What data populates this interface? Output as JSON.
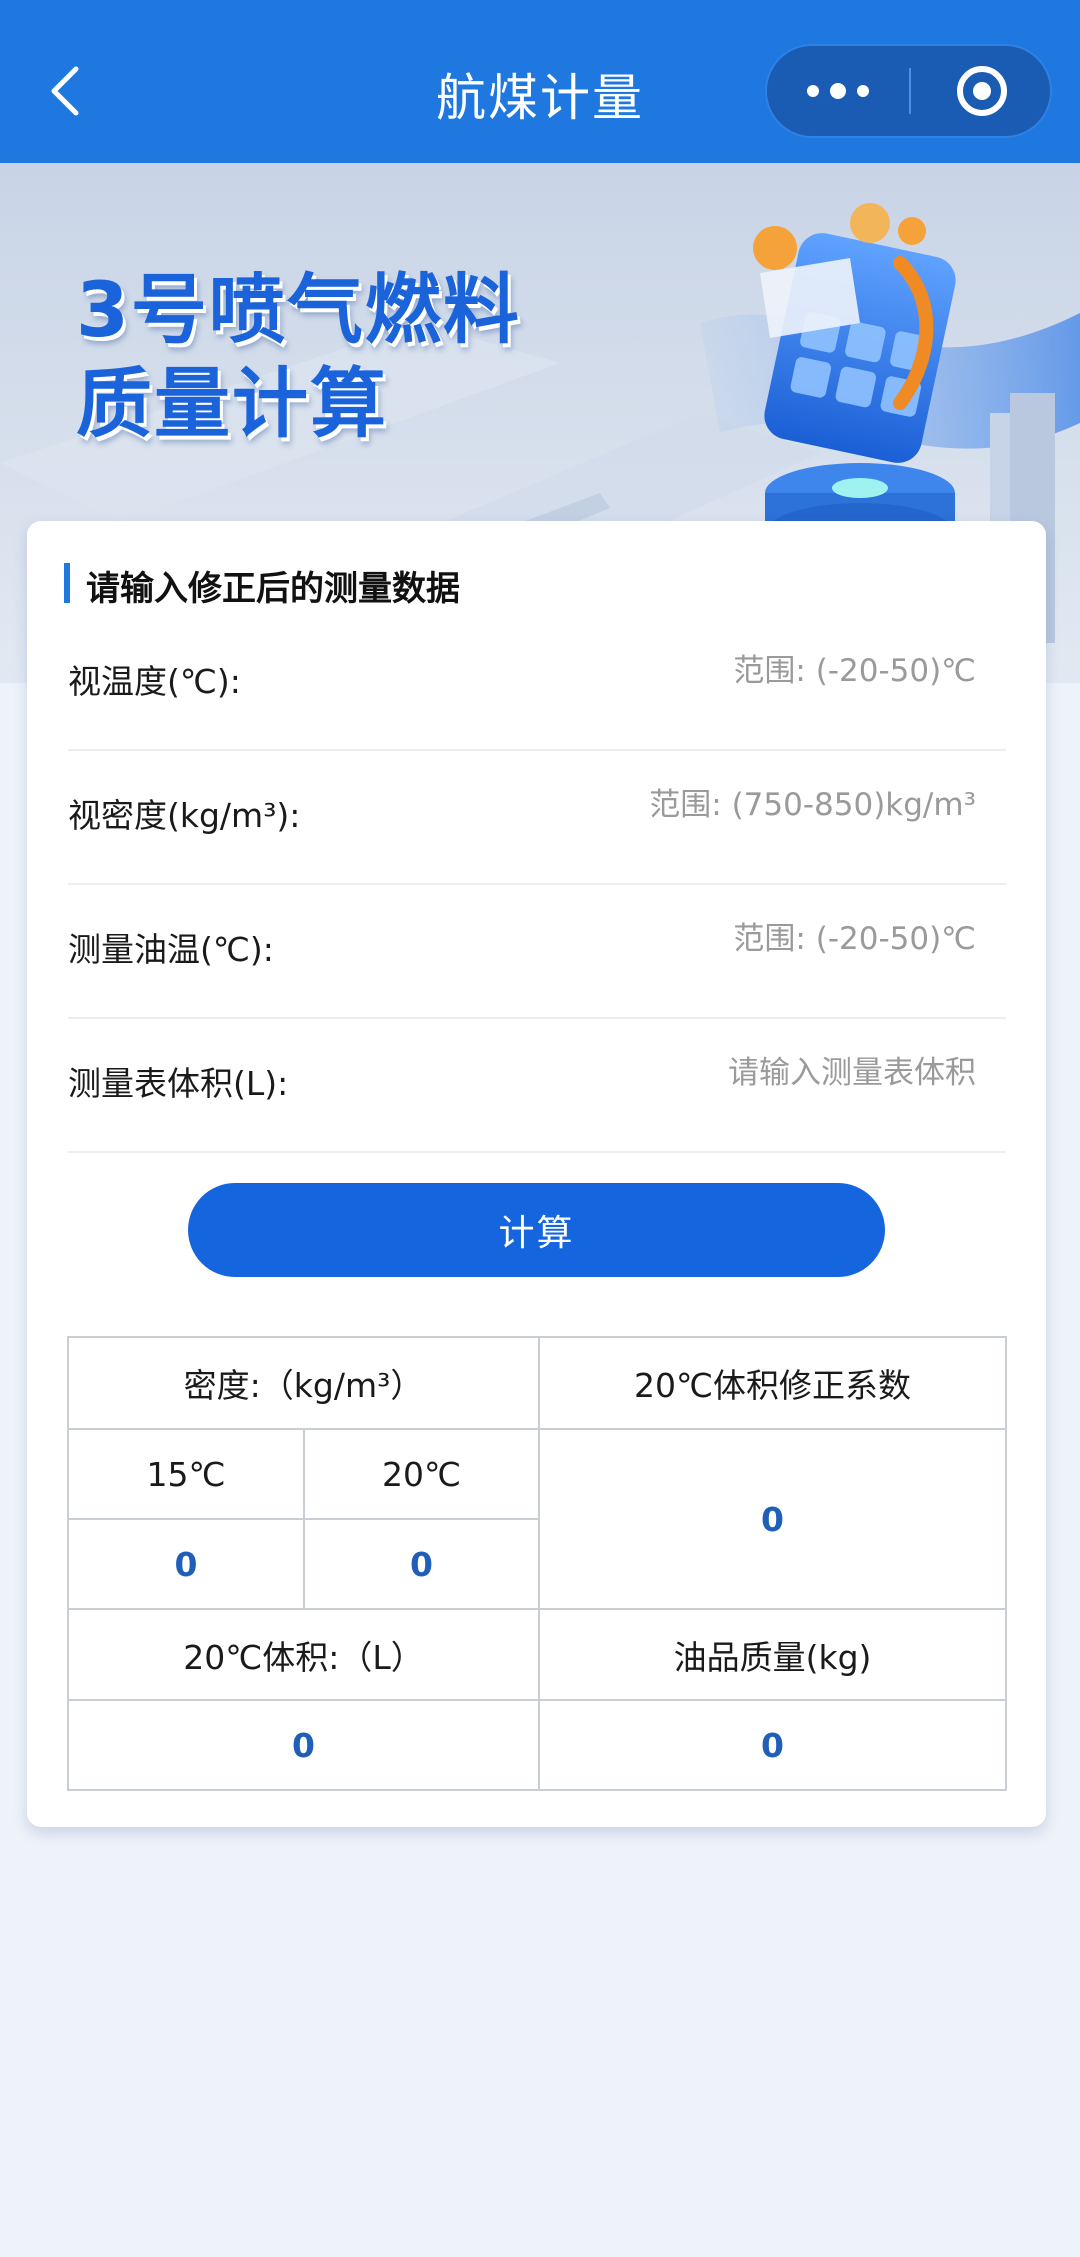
{
  "navbar": {
    "title": "航煤计量",
    "back_icon": "chevron-left-icon",
    "more_icon": "more-dots-icon",
    "close_icon": "target-circle-icon",
    "color": "#1f77e0"
  },
  "banner": {
    "title": "3号喷气燃料\n质量计算",
    "illustration": "calculator-coins-icon"
  },
  "form": {
    "section_title": "请输入修正后的测量数据",
    "fields": [
      {
        "label": "视温度(℃):",
        "value": "",
        "placeholder": "范围: (-20-50)℃"
      },
      {
        "label": "视密度(kg/m³):",
        "value": "",
        "placeholder": "范围: (750-850)kg/m³"
      },
      {
        "label": "测量油温(℃):",
        "value": "",
        "placeholder": "范围: (-20-50)℃"
      },
      {
        "label": "测量表体积(L):",
        "value": "",
        "placeholder": "请输入测量表体积"
      }
    ],
    "calc_label": "计算"
  },
  "results": {
    "density_header": "密度:（kg/m³）",
    "density_15_label": "15℃",
    "density_20_label": "20℃",
    "density_15_value": "0",
    "density_20_value": "0",
    "vcf_header": "20℃体积修正系数",
    "vcf_value": "0",
    "volume_header": "20℃体积:（L）",
    "volume_value": "0",
    "mass_header": "油品质量(kg)",
    "mass_value": "0"
  },
  "colors": {
    "accent": "#1f77e0",
    "button": "#1565de",
    "value_text": "#1f5fb8",
    "background": "#eef2f9"
  }
}
